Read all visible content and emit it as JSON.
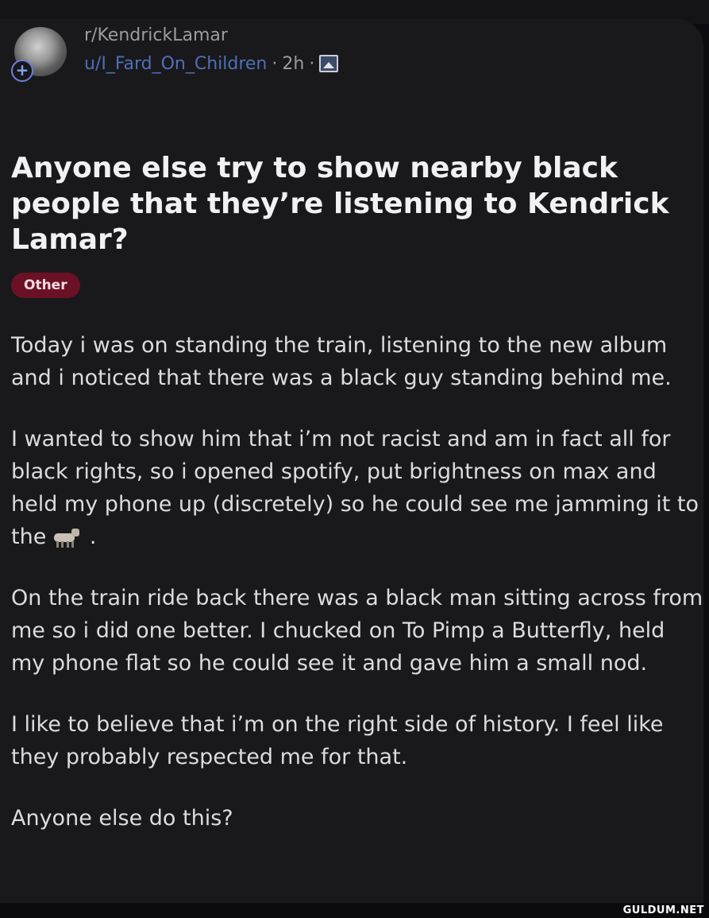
{
  "post": {
    "subreddit": "r/KendrickLamar",
    "username": "u/I_Fard_On_Children",
    "separator": "·",
    "age": "2h",
    "title": "Anyone else try to show nearby black people that they’re listening to Kendrick Lamar?",
    "flair": "Other",
    "paragraphs": [
      "Today i was on standing the train, listening to the new album and i noticed that there was a black guy standing behind me.",
      "I wanted to show him that i’m not racist and am in fact all for black rights, so i opened spotify, put brightness on max and held my phone up (discretely) so he could see me jamming it to the",
      "On the train ride back there was a black man sitting across from me so i did one better. I chucked on To Pimp a Butterfly, held my phone flat so he could see it and gave him a small nod.",
      "I like to believe that i’m on the right side of history. I feel like they probably respected me for that.",
      "Anyone else do this?"
    ],
    "paragraph2_end": " ."
  },
  "icons": {
    "avatar": "avatar-image",
    "add": "plus-icon",
    "media": "image-icon",
    "emoji": "goat-emoji-icon"
  },
  "colors": {
    "background": "#19191c",
    "username": "#4f6fb8",
    "flair_bg": "#6b1126"
  },
  "watermark": "GULDUM.NET"
}
